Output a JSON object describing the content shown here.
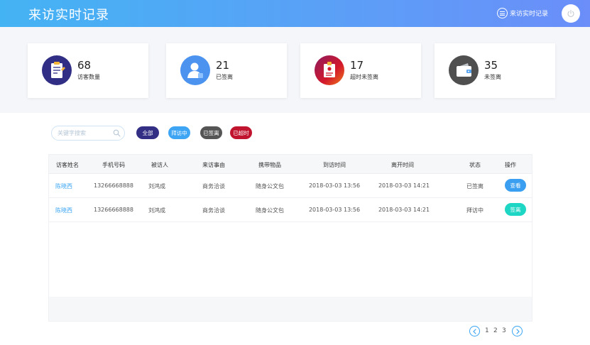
{
  "header": {
    "title": "来访实时记录",
    "record_link": "来访实时记录"
  },
  "stats": [
    {
      "value": "68",
      "label": "访客数量",
      "icon": "clipboard-icon",
      "color": "#312f85"
    },
    {
      "value": "21",
      "label": "已签离",
      "icon": "user-icon",
      "color": "#4c93f0"
    },
    {
      "value": "17",
      "label": "超时未签离",
      "icon": "badge-icon",
      "color": "#c81d3b"
    },
    {
      "value": "35",
      "label": "未签离",
      "icon": "wallet-icon",
      "color": "#4f4f4f"
    }
  ],
  "search": {
    "placeholder": "关键字搜索"
  },
  "filters": [
    {
      "label": "全部",
      "color": "#332f84"
    },
    {
      "label": "拜访中",
      "color": "#3ea4f4"
    },
    {
      "label": "已签离",
      "color": "#555555"
    },
    {
      "label": "已超时",
      "color": "#c1152f"
    }
  ],
  "table": {
    "headers": [
      "访客姓名",
      "手机号码",
      "被访人",
      "来访事由",
      "携带物品",
      "到访时间",
      "离开时间",
      "状态",
      "操作"
    ],
    "rows": [
      {
        "name": "陈晓西",
        "phone": "13266668888",
        "host": "刘鸿成",
        "reason": "商务洽谈",
        "items": "随身公文包",
        "arrive": "2018-03-03  13:56",
        "leave": "2018-03-03  14:21",
        "status": "已签离",
        "action": "查看",
        "action_color": "#3a9ff0"
      },
      {
        "name": "陈晓西",
        "phone": "13266668888",
        "host": "刘鸿成",
        "reason": "商务洽谈",
        "items": "随身公文包",
        "arrive": "2018-03-03  13:56",
        "leave": "2018-03-03  14:21",
        "status": "拜访中",
        "action": "签离",
        "action_color": "#1ed6c4"
      }
    ]
  },
  "pagination": {
    "pages": [
      "1",
      "2",
      "3"
    ],
    "accent": "#3aa4f2"
  }
}
